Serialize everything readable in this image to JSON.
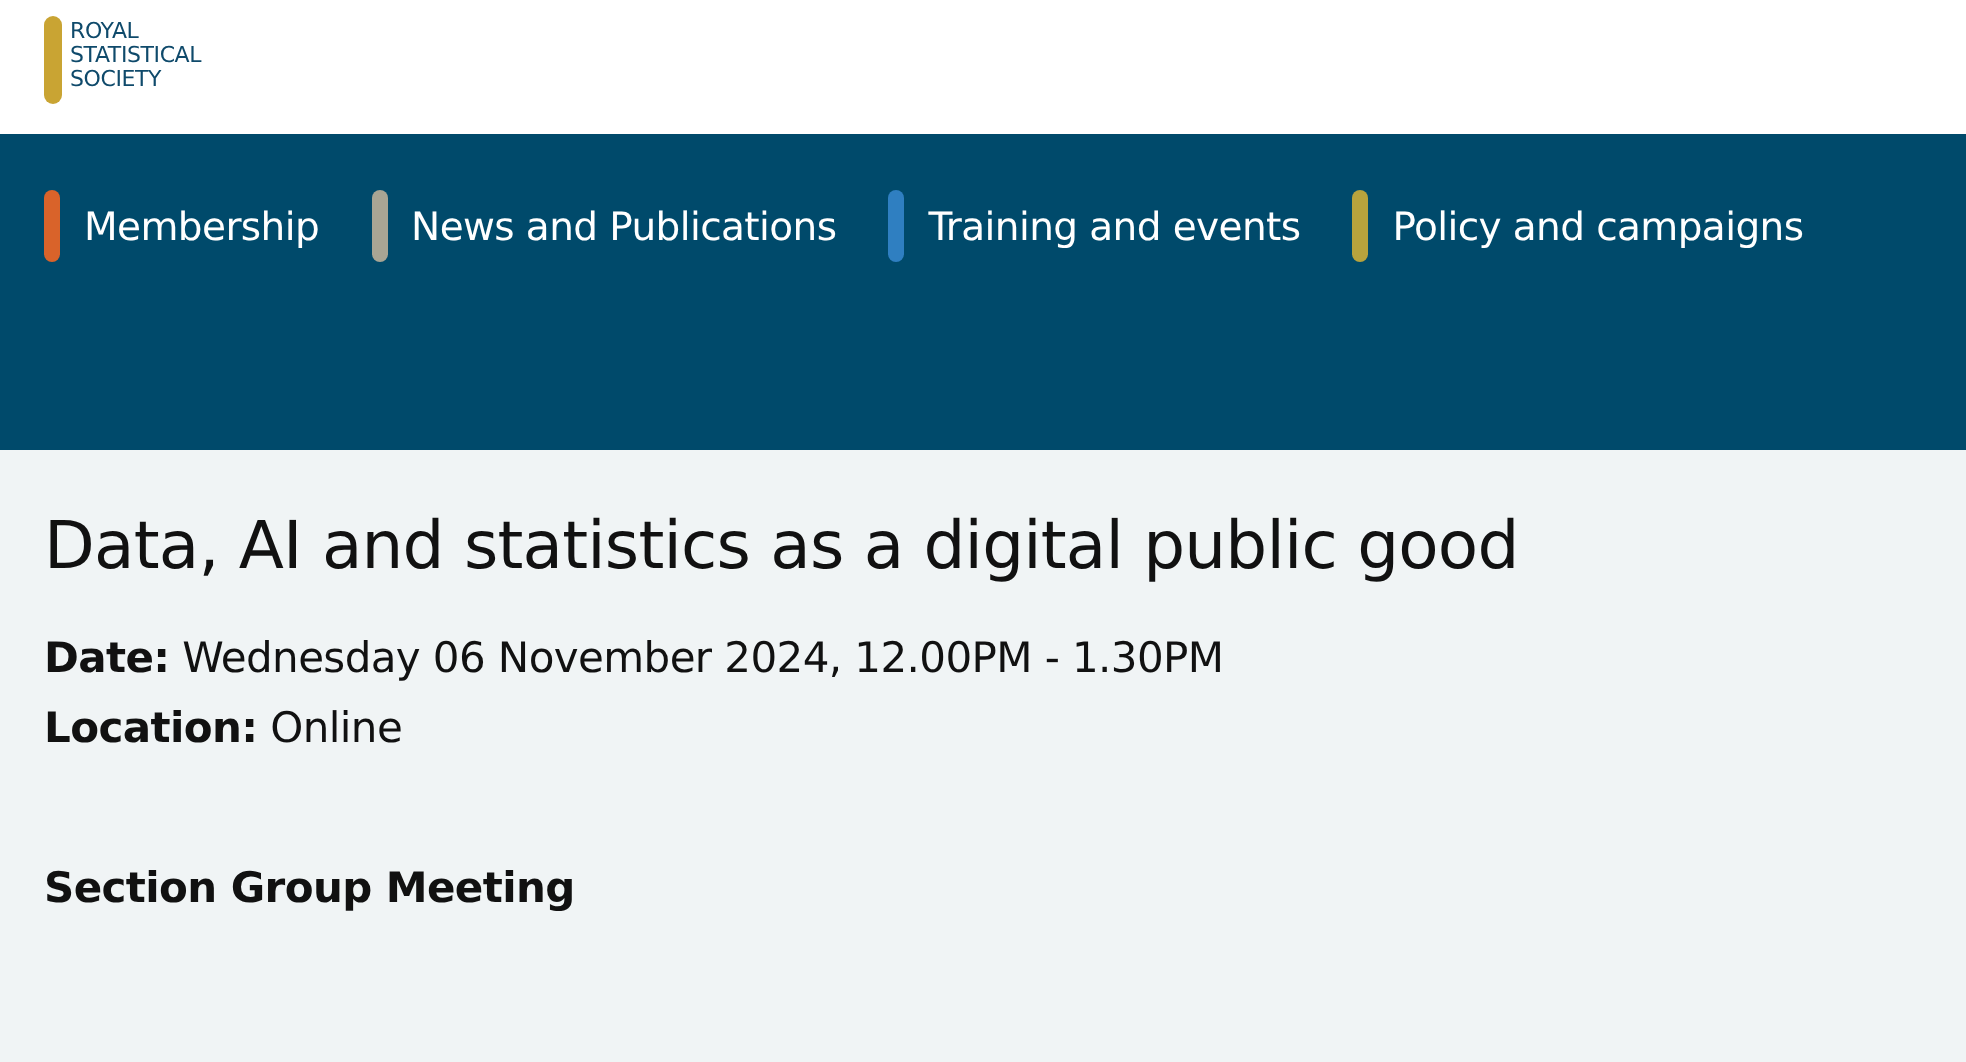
{
  "logo": {
    "lines": [
      "ROYAL",
      "STATISTICAL",
      "SOCIETY"
    ]
  },
  "nav": [
    {
      "label": "Membership",
      "color": "#d9632a"
    },
    {
      "label": "News and Publications",
      "color": "#a8a594"
    },
    {
      "label": "Training and events",
      "color": "#2f7fc1"
    },
    {
      "label": "Policy and campaigns",
      "color": "#b8a33d"
    }
  ],
  "event": {
    "title": "Data, AI and statistics as a digital public good",
    "details": [
      {
        "label": "Date:",
        "value": "Wednesday 06 November 2024, 12.00PM - 1.30PM"
      },
      {
        "label": "Location:",
        "value": "Online"
      }
    ],
    "group": "Section Group Meeting"
  }
}
